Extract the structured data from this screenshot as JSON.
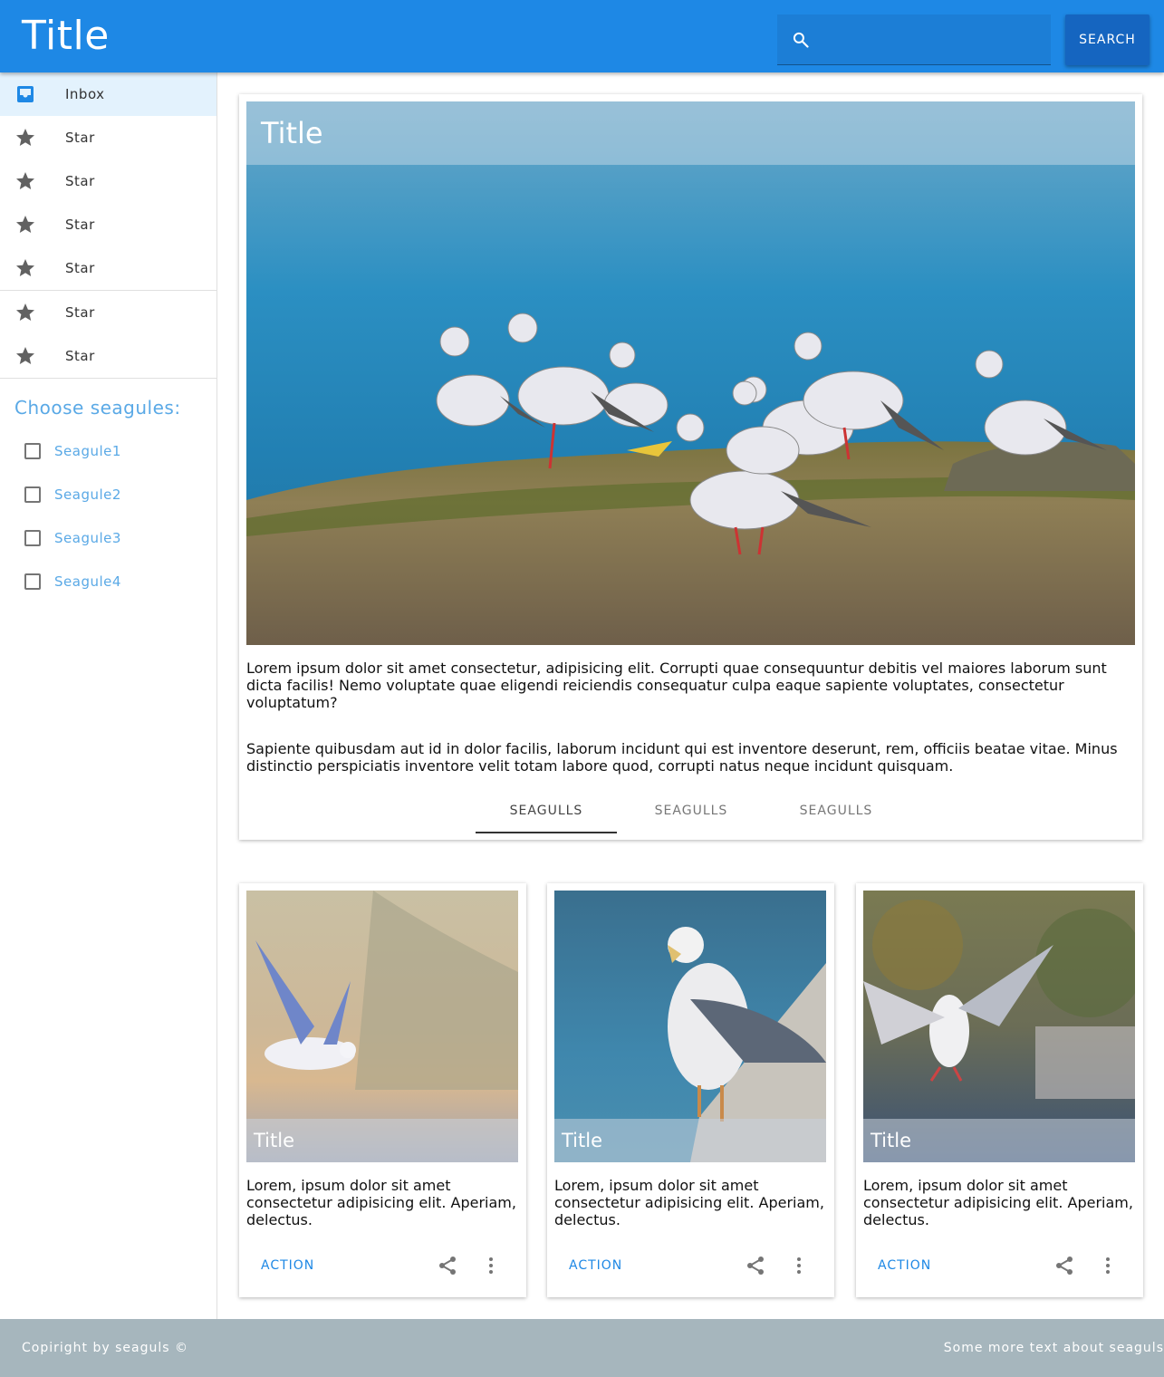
{
  "app": {
    "title": "Title"
  },
  "search": {
    "placeholder": "",
    "value": "",
    "button_label": "SEARCH"
  },
  "sidebar": {
    "nav_items": [
      {
        "label": "Inbox",
        "icon": "inbox-icon",
        "active": true
      },
      {
        "label": "Star",
        "icon": "star-icon"
      },
      {
        "label": "Star",
        "icon": "star-icon"
      },
      {
        "label": "Star",
        "icon": "star-icon"
      },
      {
        "label": "Star",
        "icon": "star-icon"
      },
      {
        "label": "Star",
        "icon": "star-icon"
      },
      {
        "label": "Star",
        "icon": "star-icon"
      }
    ],
    "choose_title": "Choose seagules:",
    "checkboxes": [
      {
        "label": "Seagule1",
        "checked": false
      },
      {
        "label": "Seagule2",
        "checked": false
      },
      {
        "label": "Seagule3",
        "checked": false
      },
      {
        "label": "Seagule4",
        "checked": false
      }
    ]
  },
  "main_card": {
    "title": "Title",
    "paragraphs": [
      "Lorem ipsum dolor sit amet consectetur, adipisicing elit. Corrupti quae consequuntur debitis vel maiores laborum sunt dicta facilis! Nemo voluptate quae eligendi reiciendis consequatur culpa eaque sapiente voluptates, consectetur voluptatum?",
      "Sapiente quibusdam aut id in dolor facilis, laborum incidunt qui est inventore deserunt, rem, officiis beatae vitae. Minus distinctio perspiciatis inventore velit totam labore quod, corrupti natus neque incidunt quisquam."
    ],
    "tabs": [
      {
        "label": "SEAGULLS",
        "active": true
      },
      {
        "label": "SEAGULLS",
        "active": false
      },
      {
        "label": "SEAGULLS",
        "active": false
      }
    ]
  },
  "cards": [
    {
      "title": "Title",
      "text": "Lorem, ipsum dolor sit amet consectetur adipisicing elit. Aperiam, delectus.",
      "action_label": "ACTION"
    },
    {
      "title": "Title",
      "text": "Lorem, ipsum dolor sit amet consectetur adipisicing elit. Aperiam, delectus.",
      "action_label": "ACTION"
    },
    {
      "title": "Title",
      "text": "Lorem, ipsum dolor sit amet consectetur adipisicing elit. Aperiam, delectus.",
      "action_label": "ACTION"
    }
  ],
  "footer": {
    "left": "Copiright by seaguls ©",
    "right": "Some more text about seaguls"
  },
  "colors": {
    "primary": "#1e88e5",
    "accent_text": "#5aa9e6",
    "footer_bg": "#a6b6bd"
  }
}
